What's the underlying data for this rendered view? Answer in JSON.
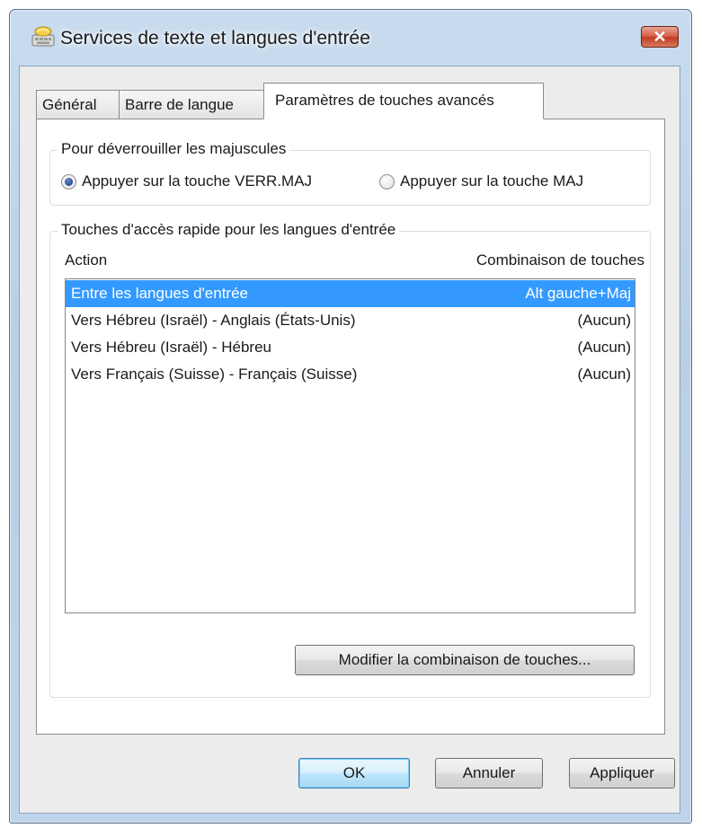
{
  "window": {
    "title": "Services de texte et langues d'entrée",
    "close_label": "✕"
  },
  "tabs": [
    {
      "label": "Général",
      "active": false
    },
    {
      "label": "Barre de langue",
      "active": false
    },
    {
      "label": "Paramètres de touches avancés",
      "active": true
    }
  ],
  "capslock_group": {
    "legend": "Pour déverrouiller les majuscules",
    "options": [
      {
        "label": "Appuyer sur la touche VERR.MAJ",
        "checked": true
      },
      {
        "label": "Appuyer sur la touche MAJ",
        "checked": false
      }
    ]
  },
  "hotkeys_group": {
    "legend": "Touches d'accès rapide pour les langues d'entrée",
    "columns": {
      "action": "Action",
      "combo": "Combinaison de touches"
    },
    "rows": [
      {
        "action": "Entre les langues d'entrée",
        "combo": "Alt gauche+Maj",
        "selected": true
      },
      {
        "action": "Vers Hébreu (Israël) - Anglais (États-Unis)",
        "combo": "(Aucun)",
        "selected": false
      },
      {
        "action": "Vers Hébreu (Israël) - Hébreu",
        "combo": "(Aucun)",
        "selected": false
      },
      {
        "action": "Vers Français (Suisse) - Français (Suisse)",
        "combo": "(Aucun)",
        "selected": false
      }
    ],
    "change_button": "Modifier la combinaison de touches..."
  },
  "footer": {
    "ok": "OK",
    "cancel": "Annuler",
    "apply": "Appliquer"
  },
  "colors": {
    "selection": "#3399ff",
    "close_button": "#c23c22"
  },
  "icons": {
    "title": "keyboard-language-icon",
    "close": "close-icon"
  }
}
